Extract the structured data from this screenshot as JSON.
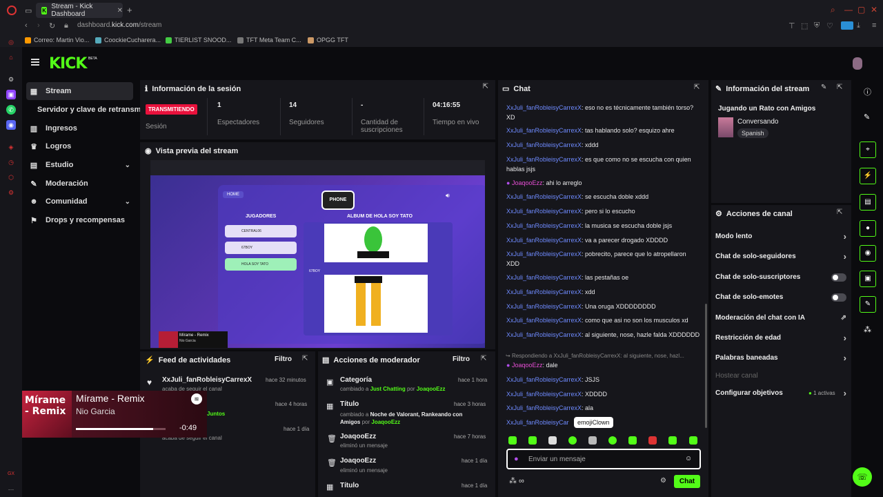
{
  "browser": {
    "tab_title": "Stream - Kick Dashboard",
    "url_prefix": "dashboard.",
    "url_domain": "kick.com",
    "url_path": "/stream",
    "bookmarks": [
      "Correo: Martin Vio...",
      "CoockieCucharera...",
      "TIERLIST SNOOD...",
      "TFT Meta Team C...",
      "OPGG TFT"
    ]
  },
  "brand": {
    "logo": "KICK",
    "beta": "BETA",
    "accent": "#53fc18"
  },
  "nav": {
    "items": [
      {
        "label": "Stream",
        "icon": "stream-icon"
      },
      {
        "label": "Servidor y clave de retransm"
      },
      {
        "label": "Ingresos",
        "icon": "chart-icon"
      },
      {
        "label": "Logros",
        "icon": "trophy-icon"
      },
      {
        "label": "Estudio",
        "icon": "studio-icon"
      },
      {
        "label": "Moderación",
        "icon": "wrench-icon"
      },
      {
        "label": "Comunidad",
        "icon": "users-icon"
      },
      {
        "label": "Drops y recompensas",
        "icon": "gift-icon"
      }
    ]
  },
  "session": {
    "title": "Información de la sesión",
    "status": "TRANSMITIENDO",
    "status_label": "Sesión",
    "viewers": "1",
    "viewers_label": "Espectadores",
    "followers": "14",
    "followers_label": "Seguidores",
    "subs": "-",
    "subs_label": "Cantidad de suscripciones",
    "uptime": "04:16:55",
    "uptime_label": "Tiempo en vivo"
  },
  "preview": {
    "title": "Vista previa del stream",
    "home": "HOME",
    "logo_text": "PHONE",
    "players_title": "JUGADORES",
    "players": [
      "CENTRAL06",
      "67BOY",
      "HOLA SOY TATO"
    ],
    "album_title": "ALBUM DE HOLA SOY TATO",
    "small_player": "67BOY",
    "mini_track": "Mírame - Remix",
    "mini_artist": "Nio Garcia"
  },
  "activity": {
    "title": "Feed de actividades",
    "filter": "Filtro",
    "items": [
      {
        "name": "XxJuli_fanRobleisyCarrexX",
        "time": "hace 32 minutos",
        "sub": "acaba de seguir el canal"
      },
      {
        "name": "",
        "time": "hace 4 horas",
        "sub": "Juntos"
      },
      {
        "name": "",
        "time": "hace 1 día",
        "sub": "acaba de seguir el canal"
      }
    ]
  },
  "modactions": {
    "title": "Acciones de moderador",
    "filter": "Filtro",
    "items": [
      {
        "title": "Categoría",
        "time": "hace 1 hora",
        "sub": "cambiado a",
        "value": "Just Chatting",
        "by": "por",
        "user": "JoaqooEzz"
      },
      {
        "title": "Título",
        "time": "hace 3 horas",
        "sub": "cambiado a",
        "value": "Noche de Valorant, Rankeando con Amigos",
        "by": "por",
        "user": "JoaqooEzz"
      },
      {
        "title": "JoaqooEzz",
        "time": "hace 7 horas",
        "sub": "eliminó un mensaje"
      },
      {
        "title": "JoaqooEzz",
        "time": "hace 1 día",
        "sub": "eliminó un mensaje"
      },
      {
        "title": "Título",
        "time": "hace 1 día"
      }
    ]
  },
  "chat": {
    "title": "Chat",
    "messages": [
      {
        "user": "XxJuli_fanRobleisyCarrexX",
        "text": ": eso no es técnicamente también torso? XD"
      },
      {
        "user": "XxJuli_fanRobleisyCarrexX",
        "text": ": tas hablando solo? esquizo ahre"
      },
      {
        "user": "XxJuli_fanRobleisyCarrexX",
        "text": ": xddd"
      },
      {
        "user": "XxJuli_fanRobleisyCarrexX",
        "text": ": es que como no se escucha con quien hablas jsjs"
      },
      {
        "user": "JoaqooEzz",
        "text": ": ahi lo arreglo",
        "mod": true
      },
      {
        "user": "XxJuli_fanRobleisyCarrexX",
        "text": ": se escucha doble xddd"
      },
      {
        "user": "XxJuli_fanRobleisyCarrexX",
        "text": ": pero si lo escucho"
      },
      {
        "user": "XxJuli_fanRobleisyCarrexX",
        "text": ": la musica se escucha doble jsjs"
      },
      {
        "user": "XxJuli_fanRobleisyCarrexX",
        "text": ": va a parecer drogado XDDDD"
      },
      {
        "user": "XxJuli_fanRobleisyCarrexX",
        "text": ": pobrecito, parece que lo atropellaron XDD"
      },
      {
        "user": "XxJuli_fanRobleisyCarrexX",
        "text": ": las pestañas oe"
      },
      {
        "user": "XxJuli_fanRobleisyCarrexX",
        "text": ": xdd"
      },
      {
        "user": "XxJuli_fanRobleisyCarrexX",
        "text": ": Una oruga XDDDDDDDD"
      },
      {
        "user": "XxJuli_fanRobleisyCarrexX",
        "text": ": como que asi no son los musculos xd"
      },
      {
        "user": "XxJuli_fanRobleisyCarrexX",
        "text": ": al siguiente, nose, hazle falda XDDDDDD"
      }
    ],
    "reply_to": "Respondiendo a XxJuli_fanRobleisyCarrexX: al siguiente, nose, hazl...",
    "reply_user": "JoaqooEzz",
    "reply_text": ": dale",
    "messages2": [
      {
        "user": "XxJuli_fanRobleisyCarrexX",
        "text": ": JSJS"
      },
      {
        "user": "XxJuli_fanRobleisyCarrexX",
        "text": ": XDDDD"
      },
      {
        "user": "XxJuli_fanRobleisyCarrexX",
        "text": ": ala"
      },
      {
        "user": "XxJuli_fanRobleisyCar",
        "text": ""
      }
    ],
    "emoji_tooltip": "emojiClown",
    "placeholder": "Enviar un mensaje",
    "send": "Chat"
  },
  "stream_info": {
    "title": "Información del stream",
    "stream_title": "Jugando un Rato con Amigos",
    "category": "Conversando",
    "language": "Spanish"
  },
  "channel_actions": {
    "title": "Acciones de canal",
    "items": [
      {
        "label": "Modo lento",
        "type": "chevron"
      },
      {
        "label": "Chat de solo-seguidores",
        "type": "chevron"
      },
      {
        "label": "Chat de solo-suscriptores",
        "type": "toggle"
      },
      {
        "label": "Chat de solo-emotes",
        "type": "toggle"
      },
      {
        "label": "Moderación del chat con IA",
        "type": "external"
      },
      {
        "label": "Restricción de edad",
        "type": "chevron"
      },
      {
        "label": "Palabras baneadas",
        "type": "chevron"
      },
      {
        "label": "Hostear canal",
        "type": "disabled"
      },
      {
        "label": "Configurar objetivos",
        "type": "chevron",
        "badge": "1 activas"
      }
    ]
  },
  "music": {
    "track": "Mírame - Remix",
    "artist": "Nio Garcia",
    "remaining": "-0:49",
    "progress": 0.86
  }
}
